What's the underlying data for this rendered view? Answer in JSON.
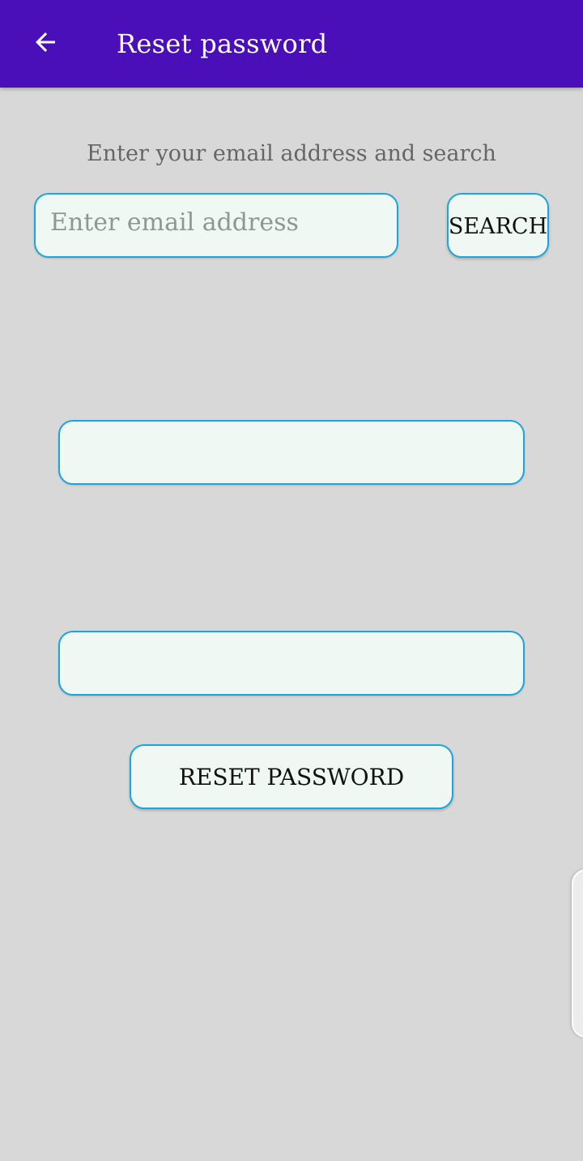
{
  "app_bar": {
    "title": "Reset password",
    "back_icon": "arrow-left-icon",
    "background_color": "#4a0fb8"
  },
  "instruction": "Enter your email address and search",
  "email_input": {
    "placeholder": "Enter email address",
    "value": ""
  },
  "search_button": {
    "label": "SEARCH"
  },
  "new_password_input": {
    "placeholder": "",
    "value": ""
  },
  "confirm_password_input": {
    "placeholder": "",
    "value": ""
  },
  "reset_button": {
    "label": "RESET PASSWORD"
  },
  "colors": {
    "screen_background": "#d8d8d8",
    "field_background": "#eff8f2",
    "field_border": "#1aa6dc"
  }
}
